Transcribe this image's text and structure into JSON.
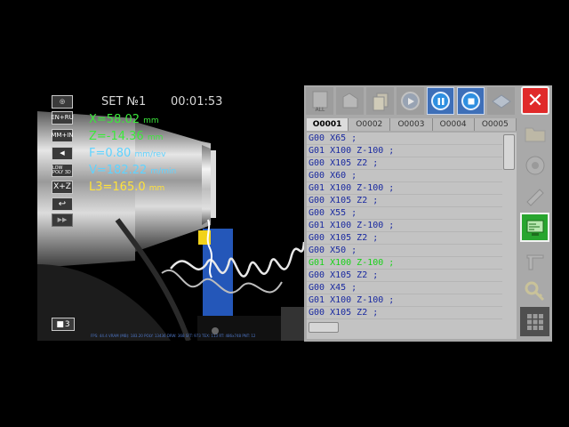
{
  "viewport": {
    "set_label": "SET №1",
    "timer": "00:01:53",
    "coords": {
      "x": {
        "label": "X=58.02",
        "unit": "mm"
      },
      "z": {
        "label": "Z=-14.36",
        "unit": "mm"
      },
      "f": {
        "label": "F=0.80",
        "unit": "mm/rev"
      },
      "v": {
        "label": "V=182.22",
        "unit": "m/min"
      },
      "l3": {
        "label": "L3=165.0",
        "unit": "mm"
      }
    },
    "buttons": {
      "camera": "◎",
      "lang": "EN+RU",
      "mode": "MM+IN",
      "sound": "◀",
      "view3d": "LOW POLY 3D",
      "axis": "X+Z",
      "return": "↩",
      "fast_forward": "▶▶",
      "camera_count": "3"
    },
    "fps_text": "FPS: 44.4  VRAM (MB): 183.20  POLY: 13436  DRW: 368  SFT: 973  TEX: 113  RT: 486x748  PNT: 12",
    "colors": {
      "coord_green": "#3be83b",
      "coord_cyan": "#5fd3ff",
      "coord_yellow": "#ffe23a",
      "tool_blue": "#2457b9"
    }
  },
  "panel": {
    "toolbar": {
      "all_label": "ALL",
      "icons": [
        "list-all-icon",
        "open-file-icon",
        "copy-icon",
        "play-icon",
        "pause-icon",
        "stop-icon",
        "eraser-icon"
      ]
    },
    "tabs": [
      "O0001",
      "O0002",
      "O0003",
      "O0004",
      "O0005"
    ],
    "active_tab": 0,
    "code_lines": [
      "G00 X65 ;",
      "G01 X100 Z-100 ;",
      "G00 X105 Z2 ;",
      "G00 X60 ;",
      "G01 X100 Z-100 ;",
      "G00 X105 Z2 ;",
      "G00 X55 ;",
      "G01 X100 Z-100 ;",
      "G00 X105 Z2 ;",
      "G00 X50 ;",
      "G01 X100 Z-100 ;",
      "G00 X105 Z2 ;",
      "G00 X45 ;",
      "G01 X100 Z-100 ;",
      "G00 X105 Z2 ;"
    ],
    "current_line": 10,
    "colors": {
      "code_blue": "#1a2aa0",
      "code_current": "#19d219",
      "close_red": "#e02a2a",
      "program_green": "#28a52f"
    }
  }
}
